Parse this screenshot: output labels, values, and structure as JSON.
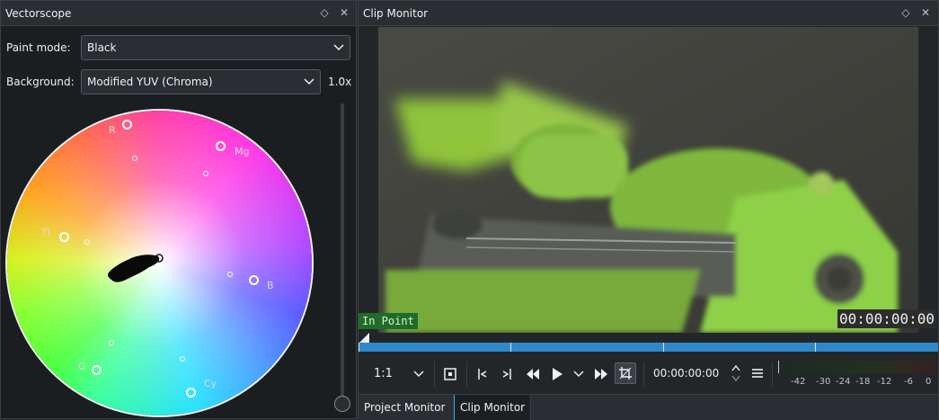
{
  "vectorscope": {
    "title": "Vectorscope",
    "paint_mode_label": "Paint mode:",
    "paint_mode_value": "Black",
    "background_label": "Background:",
    "background_value": "Modified YUV (Chroma)",
    "zoom": "1.0x",
    "wheel_labels": {
      "r": "R",
      "mg": "Mg",
      "yl": "Yl",
      "b": "B",
      "g": "G",
      "cy": "Cy"
    },
    "zoom_slider_level": 0.0
  },
  "clip_monitor": {
    "title": "Clip Monitor",
    "in_point": "In Point",
    "timecode_overlay": "00:00:00:00",
    "zoom_select": "1:1",
    "timecode": "00:00:00:00",
    "meter_scale": [
      "-42",
      "-30",
      "-24",
      "-18",
      "-12",
      "-6",
      "0"
    ],
    "tabs": [
      "Project Monitor",
      "Clip Monitor"
    ],
    "active_tab": "Clip Monitor"
  },
  "icons": {
    "float": "diamond-icon",
    "close": "close-icon",
    "dropdown": "chevron-down-icon"
  },
  "colors": {
    "accent": "#3daee9",
    "timeline_bar": "#2f89c8",
    "in_point_bg": "#1f6b2a"
  }
}
